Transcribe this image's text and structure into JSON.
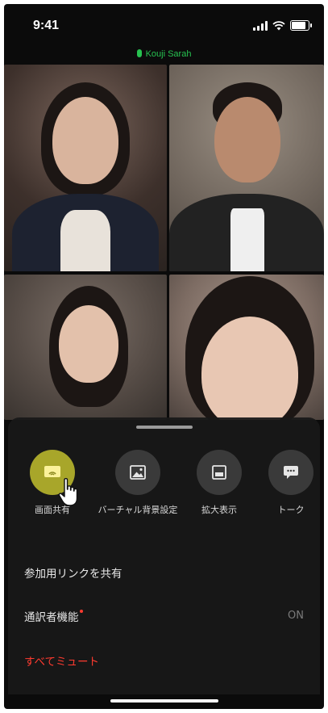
{
  "status": {
    "time": "9:41",
    "battery_level": 0.85
  },
  "speaker": {
    "names": "Kouji Sarah",
    "color": "#27c250"
  },
  "participants": [
    {
      "id": "p1",
      "active": false
    },
    {
      "id": "p2",
      "active": true
    },
    {
      "id": "p3",
      "active": false
    },
    {
      "id": "p4",
      "active": false
    }
  ],
  "actions": [
    {
      "label": "画面共有",
      "icon": "screen-share-icon",
      "highlighted": true
    },
    {
      "label": "バーチャル背景設定",
      "icon": "image-icon",
      "highlighted": false
    },
    {
      "label": "拡大表示",
      "icon": "expand-icon",
      "highlighted": false
    },
    {
      "label": "トーク",
      "icon": "chat-icon",
      "highlighted": false
    }
  ],
  "menu": {
    "share_link": "参加用リンクを共有",
    "interpreter": "通訳者機能",
    "interpreter_value": "ON",
    "mute_all": "すべてミュート"
  },
  "colors": {
    "accent": "#27c250",
    "highlight": "#a8a62a",
    "danger": "#ff3b30"
  }
}
